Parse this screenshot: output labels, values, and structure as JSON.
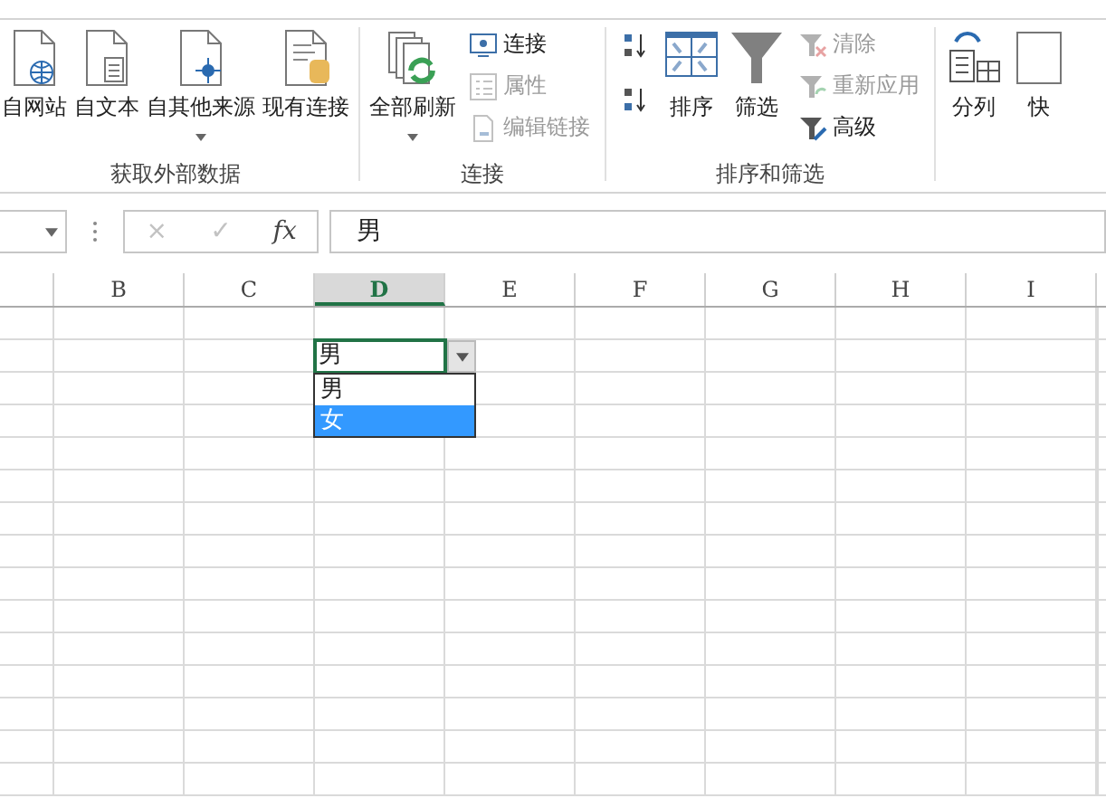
{
  "ribbon": {
    "groups": [
      {
        "label": "获取外部数据",
        "items": [
          {
            "kind": "web",
            "label": "自网站",
            "menu": false
          },
          {
            "kind": "text",
            "label": "自文本",
            "menu": false
          },
          {
            "kind": "other",
            "label": "自其他来源",
            "menu": true
          },
          {
            "kind": "existing",
            "label": "现有连接",
            "menu": false
          }
        ]
      },
      {
        "label": "连接",
        "items": [
          {
            "kind": "refresh",
            "label": "全部刷新",
            "menu": true
          },
          {
            "kind": "stack",
            "children": [
              {
                "kind": "connection",
                "label": "连接",
                "disabled": false
              },
              {
                "kind": "properties",
                "label": "属性",
                "disabled": true
              },
              {
                "kind": "links",
                "label": "编辑链接",
                "disabled": true
              }
            ]
          }
        ]
      },
      {
        "label": "排序和筛选",
        "items": [
          {
            "kind": "sortpair"
          },
          {
            "kind": "sort",
            "label": "排序",
            "menu": false
          },
          {
            "kind": "filter",
            "label": "筛选",
            "menu": false
          },
          {
            "kind": "stack",
            "children": [
              {
                "kind": "clear",
                "label": "清除",
                "disabled": true
              },
              {
                "kind": "reapply",
                "label": "重新应用",
                "disabled": true
              },
              {
                "kind": "advanced",
                "label": "高级",
                "disabled": false
              }
            ]
          }
        ]
      },
      {
        "items": [
          {
            "kind": "split",
            "label": "分列",
            "menu": false
          },
          {
            "kind": "flash",
            "label": "快",
            "menu": false
          }
        ]
      }
    ]
  },
  "formula_bar": {
    "cancel": "×",
    "enter": "✓",
    "function": "fx",
    "value": "男"
  },
  "sheet": {
    "columns": [
      {
        "selected": false
      },
      {
        "label": "B",
        "selected": false
      },
      {
        "label": "C",
        "selected": false
      },
      {
        "label": "D",
        "selected": true
      },
      {
        "label": "E",
        "selected": false
      },
      {
        "label": "F",
        "selected": false
      },
      {
        "label": "G",
        "selected": false
      },
      {
        "label": "H",
        "selected": false
      },
      {
        "label": "I",
        "selected": false
      }
    ],
    "active_cell": {
      "value": "男"
    },
    "dropdown": [
      {
        "label": "男",
        "selected": false
      },
      {
        "label": "女",
        "selected": true
      }
    ]
  }
}
